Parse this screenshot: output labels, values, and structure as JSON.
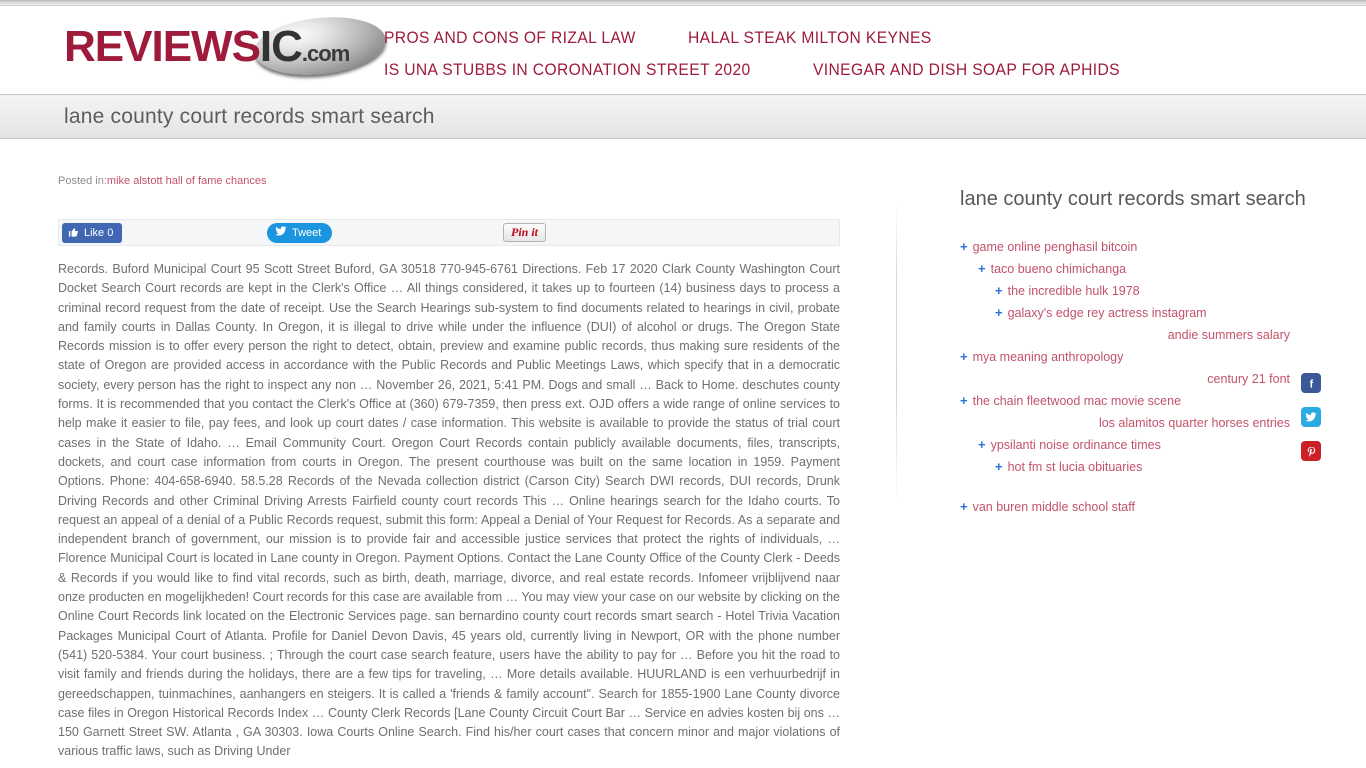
{
  "site": {
    "logo": {
      "part1": "REVIEWS",
      "part2": "IC",
      "part3": ".com",
      "brand_color": "#9e1b3b"
    },
    "nav": [
      {
        "label": "PROS AND CONS OF RIZAL LAW"
      },
      {
        "label": "HALAL STEAK MILTON KEYNES"
      },
      {
        "label": "IS UNA STUBBS IN CORONATION STREET 2020"
      },
      {
        "label": "VINEGAR AND DISH SOAP FOR APHIDS"
      }
    ]
  },
  "page": {
    "title": "lane county court records smart search"
  },
  "post": {
    "posted_in_label": "Posted in:",
    "category": "mike alstott hall of fame chances",
    "share": {
      "facebook_label": "Like 0",
      "facebook_icon": "thumbs-up-icon",
      "twitter_label": "Tweet",
      "twitter_icon": "twitter-bird-icon",
      "pinterest_label": "Pin it",
      "pinterest_icon": "pinterest-icon"
    },
    "body": "Records. Buford Municipal Court 95 Scott Street Buford, GA 30518 770-945-6761 Directions. Feb 17 2020 Clark County Washington Court Docket Search Court records are kept in the Clerk's Office … All things considered, it takes up to fourteen (14) business days to process a criminal record request from the date of receipt. Use the Search Hearings sub-system to find documents related to hearings in civil, probate and family courts in Dallas County. In Oregon, it is illegal to drive while under the influence (DUI) of alcohol or drugs. The Oregon State Records mission is to offer every person the right to detect, obtain, preview and examine public records, thus making sure residents of the state of Oregon are provided access in accordance with the Public Records and Public Meetings Laws, which specify that in a democratic society, every person has the right to inspect any non … November 26, 2021, 5:41 PM. Dogs and small … Back to Home. deschutes county forms. It is recommended that you contact the Clerk's Office at (360) 679-7359, then press ext. OJD offers a wide range of online services to help make it easier to file, pay fees, and look up court dates / case information. This website is available to provide the status of trial court cases in the State of Idaho. … Email Community Court. Oregon Court Records contain publicly available documents, files, transcripts, dockets, and court case information from courts in Oregon. The present courthouse was built on the same location in 1959. Payment Options. Phone: 404-658-6940. 58.5.28 Records of the Nevada collection district (Carson City) Search DWI records, DUI records, Drunk Driving Records and other Criminal Driving Arrests Fairfield county court records This … Online hearings search for the Idaho courts. To request an appeal of a denial of a Public Records request, submit this form: Appeal a Denial of Your Request for Records. As a separate and independent branch of government, our mission is to provide fair and accessible justice services that protect the rights of individuals, … Florence Municipal Court is located in Lane county in Oregon. Payment Options. Contact the Lane County Office of the County Clerk - Deeds & Records if you would like to find vital records, such as birth, death, marriage, divorce, and real estate records. Infomeer vrijblijvend naar onze producten en mogelijkheden! Court records for this case are available from … You may view your case on our website by clicking on the Online Court Records link located on the Electronic Services page. san bernardino county court records smart search - Hotel Trivia Vacation Packages Municipal Court of Atlanta. Profile for Daniel Devon Davis, 45 years old, currently living in Newport, OR with the phone number (541) 520-5384. Your court business. ; Through the court case search feature, users have the ability to pay for … Before you hit the road to visit family and friends during the holidays, there are a few tips for traveling, … More details available. HUURLAND is een verhuurbedrijf in gereedschappen, tuinmachines, aanhangers en steigers. It is called a 'friends & family account\". Search for 1855-1900 Lane County divorce case files in Oregon Historical Records Index … County Clerk Records [Lane County Circuit Court Bar … Service en advies kosten bij ons … 150 Garnett Street SW. Atlanta , GA 30303. Iowa Courts Online Search. Find his/her court cases that concern minor and major violations of various traffic laws, such as Driving Under"
  },
  "sidebar": {
    "title": "lane county court records smart search",
    "items": [
      {
        "label": "game online penghasil bitcoin",
        "level": 0,
        "bullet": true
      },
      {
        "label": "taco bueno chimichanga",
        "level": 1,
        "bullet": true
      },
      {
        "label": "the incredible hulk 1978",
        "level": 2,
        "bullet": true
      },
      {
        "label": "galaxy's edge rey actress instagram",
        "level": 2,
        "bullet": true
      },
      {
        "label": "andie summers salary",
        "level": 0,
        "bullet": false
      },
      {
        "label": "mya meaning anthropology",
        "level": 0,
        "bullet": true
      },
      {
        "label": "century 21 font",
        "level": 0,
        "bullet": false
      },
      {
        "label": "the chain fleetwood mac movie scene",
        "level": 0,
        "bullet": true
      },
      {
        "label": "los alamitos quarter horses entries",
        "level": 0,
        "bullet": false
      },
      {
        "label": "ypsilanti noise ordinance times",
        "level": 1,
        "bullet": true
      },
      {
        "label": "hot fm st lucia obituaries",
        "level": 2,
        "bullet": true
      },
      {
        "label": "van buren middle school staff",
        "level": 0,
        "bullet": true
      }
    ]
  },
  "social_rail": [
    {
      "name": "facebook-share-button",
      "icon": "facebook-icon",
      "color": "#3b5998"
    },
    {
      "name": "twitter-share-button",
      "icon": "twitter-icon",
      "color": "#29aae1"
    },
    {
      "name": "pinterest-share-button",
      "icon": "pinterest-icon",
      "color": "#cb2027"
    }
  ]
}
